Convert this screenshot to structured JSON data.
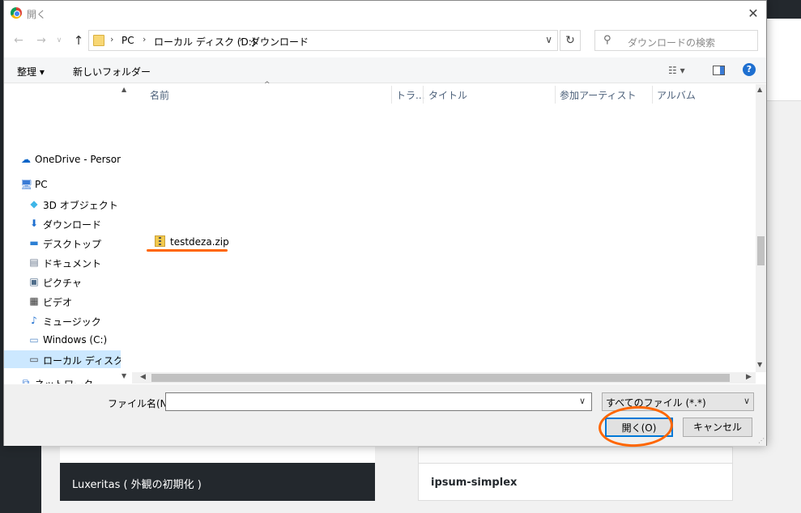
{
  "window": {
    "title": "開く",
    "close_glyph": "✕"
  },
  "nav": {
    "back": "←",
    "forward": "→",
    "recent": "∨",
    "up": "↑",
    "breadcrumb": [
      "PC",
      "ローカル ディスク (D:)",
      "ダウンロード"
    ],
    "breadcrumb_sep": "›",
    "address_dropdown": "∨",
    "refresh": "↻",
    "search_placeholder": "ダウンロードの検索",
    "search_glyph": "⚲"
  },
  "toolbar": {
    "organize": "整理 ▾",
    "new_folder": "新しいフォルダー",
    "view_glyph": "☷ ▾",
    "help": "?"
  },
  "navpane": {
    "items": [
      {
        "label": "OneDrive - Personal",
        "icon": "cloud-icon",
        "glyph": "☁",
        "color": "#0a64c8"
      },
      {
        "label": "PC",
        "icon": "computer-icon",
        "glyph": "🖥",
        "color": "#3a7bd5"
      },
      {
        "label": "3D オブジェクト",
        "icon": "cube-icon",
        "glyph": "◆",
        "color": "#3fb6e8"
      },
      {
        "label": "ダウンロード",
        "icon": "download-icon",
        "glyph": "⬇",
        "color": "#1e6fd0"
      },
      {
        "label": "デスクトップ",
        "icon": "desktop-icon",
        "glyph": "▬",
        "color": "#2b7fd4"
      },
      {
        "label": "ドキュメント",
        "icon": "document-icon",
        "glyph": "▤",
        "color": "#6b7a8f"
      },
      {
        "label": "ピクチャ",
        "icon": "picture-icon",
        "glyph": "▣",
        "color": "#4f6d8a"
      },
      {
        "label": "ビデオ",
        "icon": "video-icon",
        "glyph": "▦",
        "color": "#333333"
      },
      {
        "label": "ミュージック",
        "icon": "music-icon",
        "glyph": "♪",
        "color": "#1e6fd0"
      },
      {
        "label": "Windows (C:)",
        "icon": "drive-icon",
        "glyph": "▭",
        "color": "#5a8ec9"
      },
      {
        "label": "ローカル ディスク (D:)",
        "icon": "drive-icon",
        "glyph": "▭",
        "color": "#444444"
      },
      {
        "label": "ネットワーク",
        "icon": "network-icon",
        "glyph": "⧉",
        "color": "#3a7bd5"
      }
    ],
    "selected_index": 10
  },
  "columns": [
    "名前",
    "トラ...",
    "タイトル",
    "参加アーティスト",
    "アルバム"
  ],
  "files": [
    {
      "name": "testdeza.zip",
      "icon": "zip-folder-icon"
    }
  ],
  "bottom": {
    "filename_label": "ファイル名(N):",
    "filename_value": "",
    "filter_value": "すべてのファイル (*.*)",
    "open_label": "開く(O)",
    "cancel_label": "キャンセル"
  },
  "background": {
    "theme_cards": [
      "Luxeritas ( 外観の初期化 )",
      "ipsum-simplex"
    ]
  },
  "colors": {
    "annotation": "#ff6600",
    "selection": "#cce8ff",
    "accent": "#0078d7"
  }
}
